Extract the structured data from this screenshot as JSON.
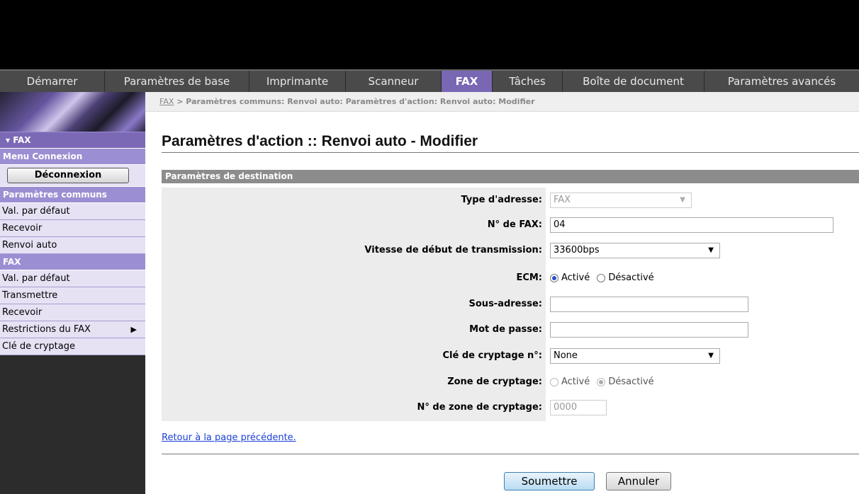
{
  "nav": {
    "tabs": [
      {
        "label": "Démarrer",
        "active": false
      },
      {
        "label": "Paramètres de base",
        "active": false
      },
      {
        "label": "Imprimante",
        "active": false
      },
      {
        "label": "Scanneur",
        "active": false
      },
      {
        "label": "FAX",
        "active": true
      },
      {
        "label": "Tâches",
        "active": false
      },
      {
        "label": "Boîte de document",
        "active": false
      },
      {
        "label": "Paramètres avancés",
        "active": false
      }
    ]
  },
  "sidebar": {
    "section_title": "▾ FAX",
    "login_menu": "Menu Connexion",
    "logout_button": "Déconnexion",
    "common_header": "Paramètres communs",
    "common_items": [
      "Val. par défaut",
      "Recevoir",
      "Renvoi auto"
    ],
    "fax_header": "FAX",
    "fax_items": [
      "Val. par défaut",
      "Transmettre",
      "Recevoir",
      "Restrictions du FAX",
      "Clé de cryptage"
    ],
    "submenu_arrow": "▶"
  },
  "breadcrumb": {
    "link": "FAX",
    "separator": ">",
    "path": "Paramètres communs: Renvoi auto: Paramètres d'action: Renvoi auto: Modifier"
  },
  "page": {
    "title": "Paramètres d'action :: Renvoi auto - Modifier",
    "section_title": "Paramètres de destination"
  },
  "form": {
    "address_type": {
      "label": "Type d'adresse:",
      "value": "FAX",
      "disabled": true
    },
    "fax_number": {
      "label": "N° de FAX:",
      "value": "04"
    },
    "start_speed": {
      "label": "Vitesse de début de transmission:",
      "value": "33600bps"
    },
    "ecm": {
      "label": "ECM:",
      "options": [
        "Activé",
        "Désactivé"
      ],
      "selected": "Activé"
    },
    "sub_address": {
      "label": "Sous-adresse:",
      "value": ""
    },
    "password": {
      "label": "Mot de passe:",
      "value": ""
    },
    "encryption_key": {
      "label": "Clé de cryptage n°:",
      "value": "None"
    },
    "encryption_zone": {
      "label": "Zone de cryptage:",
      "options": [
        "Activé",
        "Désactivé"
      ],
      "selected": "Désactivé",
      "disabled": true
    },
    "encryption_zone_no": {
      "label": "N° de zone de cryptage:",
      "value": "0000",
      "disabled": true
    }
  },
  "footer": {
    "back_link": "Retour à la page précédente.",
    "submit_label": "Soumettre",
    "cancel_label": "Annuler"
  },
  "colors": {
    "active_tab": "#7a67b4",
    "sidebar_header": "#7b69b6",
    "sidebar_item_bg": "#e6e2f4",
    "section_bar": "#8c8c8c",
    "link": "#1b3fd8"
  },
  "icons": {
    "dropdown": "chevron-down-icon",
    "submenu": "chevron-right-icon"
  }
}
